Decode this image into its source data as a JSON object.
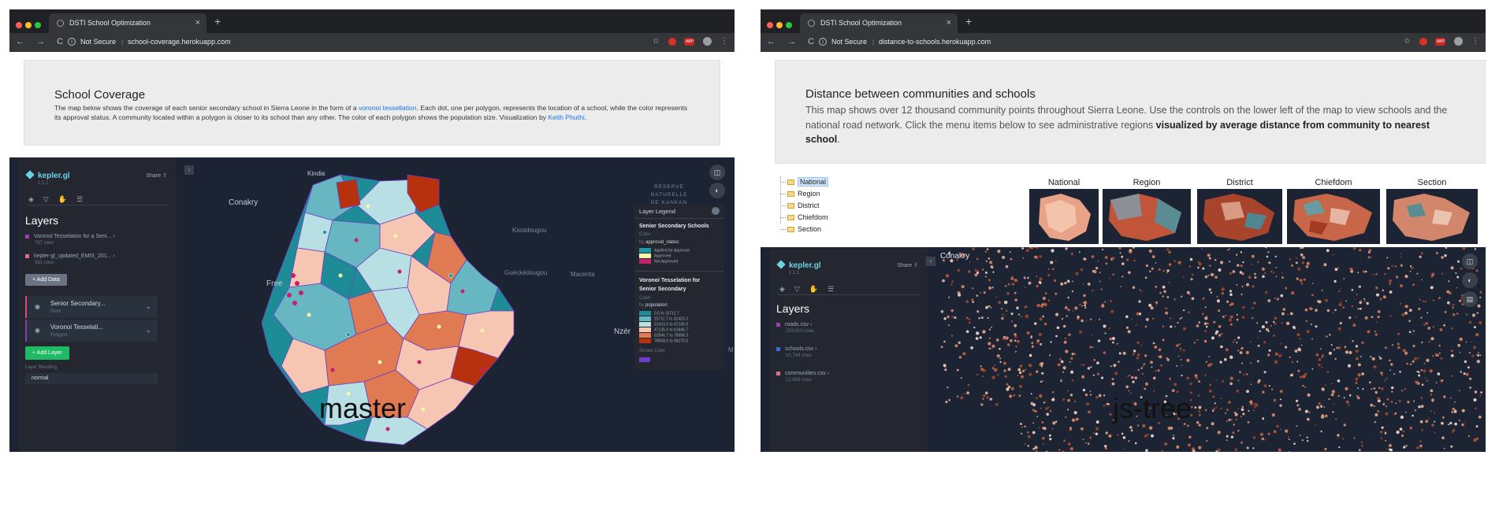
{
  "left": {
    "browser": {
      "tab_title": "DSTI School Optimization",
      "tab_close": "×",
      "new_tab": "+",
      "nav": "← → C",
      "security": "Not Secure",
      "url": "school-coverage.herokuapp.com",
      "abp": "ABP"
    },
    "intro": {
      "title": "School Coverage",
      "text_before": "The map below shows the coverage of each senior secondary school in Sierra Leone in the form of a ",
      "link1": "voronoi tessellation",
      "text_mid": ". Each dot, one per polygon, represents the location of a school, while the color represents its approval status. A community located within a polygon is closer to its school than any other. The color of each polygon shows the population size. Visualization by ",
      "link2": "Keith Phuthi",
      "text_end": "."
    },
    "panel": {
      "brand": "kepler.gl",
      "version": "1.1.1",
      "share": "Share",
      "layers_title": "Layers",
      "datasets": [
        {
          "name": "Voronoi Tesselation for a Seni...",
          "rows": "767 rows",
          "color": "#a23bb8"
        },
        {
          "name": "kepler-gl_updated_EMIS_201...",
          "rows": "581 rows",
          "color": "#e56a8f"
        }
      ],
      "add_data": "+ Add Data",
      "layers": [
        {
          "name": "Senior Secondary...",
          "type": "Point",
          "color": "#e0467d"
        },
        {
          "name": "Voronoi Tesselati...",
          "type": "Polygon",
          "color": "#7b3fb3"
        }
      ],
      "add_layer": "+ Add Layer",
      "blending_label": "Layer Blending",
      "blending_value": "normal"
    },
    "map_labels": {
      "kindia": "Kindia",
      "conakry": "Conakry",
      "reserve": "RÉSERVE NATURELLE DE KANKAN",
      "kissidougou": "Kissidougou",
      "gueckedougou": "Guéckédougou",
      "macenta": "Macenta",
      "nzero": "Nzér",
      "freetown": "Free",
      "m": "M"
    },
    "legend": {
      "header": "Layer Legend",
      "title1": "Senior Secondary Schools",
      "sub1": "Color",
      "by1_prefix": "by ",
      "by1_field": "approval_status",
      "items1": [
        {
          "label": "Applied for Approval",
          "color": "#1b9aaa"
        },
        {
          "label": "Approved",
          "color": "#f6f7a8"
        },
        {
          "label": "Not Approved",
          "color": "#c71f6b"
        }
      ],
      "title2": "Voronoi Tesselation for Senior Secondary",
      "sub2": "Color",
      "by2_prefix": "by ",
      "by2_field": "population",
      "items2": [
        {
          "label": "0.0 to 15711.7",
          "color": "#1d8c97"
        },
        {
          "label": "15711.7 to 31423.3",
          "color": "#67b7c3"
        },
        {
          "label": "31423.3 to 47135.0",
          "color": "#b8dfe3"
        },
        {
          "label": "47135.0 to 62846.7",
          "color": "#f6c6b3"
        },
        {
          "label": "62846.7 to 78558.3",
          "color": "#e07a52"
        },
        {
          "label": "78558.3 to 94270.0",
          "color": "#b7310f"
        }
      ],
      "stroke_label": "Stroke Color",
      "stroke_color": "#6a3fc6"
    },
    "caption": "master"
  },
  "right": {
    "browser": {
      "tab_title": "DSTI School Optimization",
      "tab_close": "×",
      "new_tab": "+",
      "nav": "← → C",
      "security": "Not Secure",
      "url": "distance-to-schools.herokuapp.com",
      "abp": "ABP"
    },
    "intro": {
      "title": "Distance between communities and schools",
      "text": "This map shows over 12 thousand community points throughout Sierra Leone. Use the controls on the lower left of the map to view schools and the national road network. Click the menu items below to see administrative regions ",
      "bold": "visualized by average distance from community to nearest school",
      "text_end": "."
    },
    "tree": [
      "National",
      "Region",
      "District",
      "Chiefdom",
      "Section"
    ],
    "thumbnails": [
      "National",
      "Region",
      "District",
      "Chiefdom",
      "Section"
    ],
    "panel": {
      "brand": "kepler.gl",
      "version": "1.1.1",
      "share": "Share",
      "layers_title": "Layers",
      "datasets": [
        {
          "name": "roads.csv",
          "rows": "253,010 rows",
          "color": "#a23bb8"
        },
        {
          "name": "schools.csv",
          "rows": "10,744 rows",
          "color": "#2f6fe0"
        },
        {
          "name": "communities.csv",
          "rows": "12,856 rows",
          "color": "#e56a8f"
        }
      ]
    },
    "map_labels": {
      "conakry": "Conakry"
    },
    "caption": "js-tree"
  }
}
